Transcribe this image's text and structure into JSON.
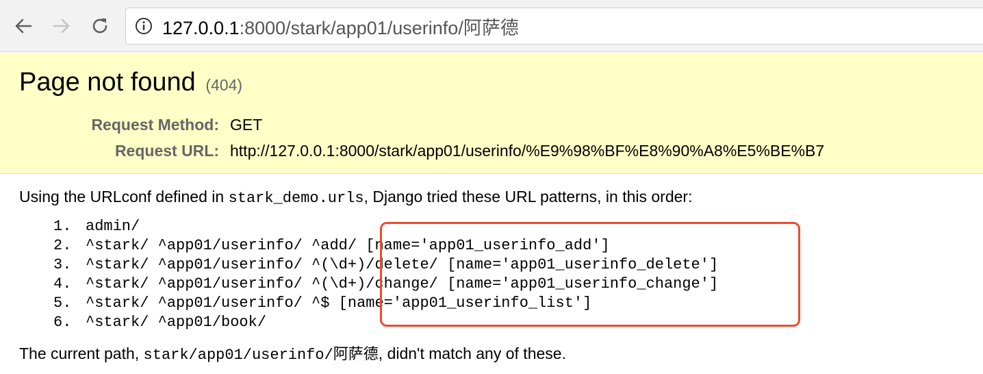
{
  "browser": {
    "url_host": "127.0.0.1",
    "url_rest": ":8000/stark/app01/userinfo/阿萨德",
    "icons": {
      "back": "arrow-left-icon",
      "forward": "arrow-right-icon",
      "reload": "reload-icon",
      "info": "info-circle-icon"
    }
  },
  "summary": {
    "title": "Page not found",
    "code": "(404)",
    "method_label": "Request Method:",
    "method_value": "GET",
    "url_label": "Request URL:",
    "url_value": "http://127.0.0.1:8000/stark/app01/userinfo/%E9%98%BF%E8%90%A8%E5%BE%B7"
  },
  "info": {
    "intro_before": "Using the URLconf defined in ",
    "intro_module": "stark_demo.urls",
    "intro_after": ", Django tried these URL patterns, in this order:",
    "patterns": [
      {
        "num": "1.",
        "text": "admin/"
      },
      {
        "num": "2.",
        "text": "^stark/ ^app01/userinfo/ ^add/ [name='app01_userinfo_add']"
      },
      {
        "num": "3.",
        "text": "^stark/ ^app01/userinfo/ ^(\\d+)/delete/ [name='app01_userinfo_delete']"
      },
      {
        "num": "4.",
        "text": "^stark/ ^app01/userinfo/ ^(\\d+)/change/ [name='app01_userinfo_change']"
      },
      {
        "num": "5.",
        "text": "^stark/ ^app01/userinfo/ ^$ [name='app01_userinfo_list']"
      },
      {
        "num": "6.",
        "text": "^stark/ ^app01/book/"
      }
    ],
    "footer_before": "The current path, ",
    "footer_path": "stark/app01/userinfo/阿萨德",
    "footer_after": ", didn't match any of these."
  },
  "colors": {
    "summary_bg": "#ffffc8",
    "annotation": "#f04a2c",
    "label_gray": "#666666"
  }
}
